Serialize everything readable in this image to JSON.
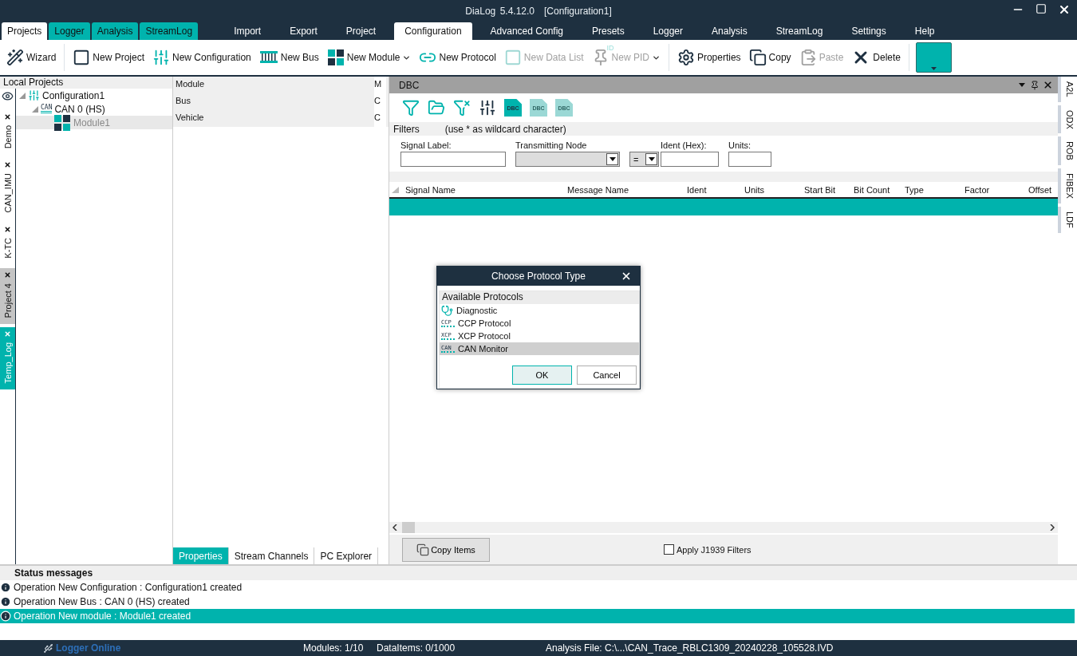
{
  "window": {
    "title": "DiaLog 5.4.12.0",
    "document": "[Configuration1]"
  },
  "side_tabs": [
    {
      "label": "Projects",
      "selected": true
    },
    {
      "label": "Logger",
      "selected": false
    },
    {
      "label": "Analysis",
      "selected": false
    },
    {
      "label": "StreamLog",
      "selected": false
    }
  ],
  "menu_tabs": [
    {
      "label": "Import",
      "selected": false
    },
    {
      "label": "Export",
      "selected": false
    },
    {
      "label": "Project",
      "selected": false
    },
    {
      "label": "Configuration",
      "selected": true
    },
    {
      "label": "Advanced Config",
      "selected": false
    },
    {
      "label": "Presets",
      "selected": false
    },
    {
      "label": "Logger",
      "selected": false
    },
    {
      "label": "Analysis",
      "selected": false
    },
    {
      "label": "StreamLog",
      "selected": false
    },
    {
      "label": "Settings",
      "selected": false
    },
    {
      "label": "Help",
      "selected": false
    }
  ],
  "toolbar": [
    {
      "kind": "button",
      "label": "Wizard",
      "disabled": false,
      "dropdown": false
    },
    {
      "kind": "separator"
    },
    {
      "kind": "button",
      "label": "New Project",
      "disabled": false,
      "dropdown": false
    },
    {
      "kind": "button",
      "label": "New Configuration",
      "disabled": false,
      "dropdown": false
    },
    {
      "kind": "button",
      "label": "New Bus",
      "disabled": false,
      "dropdown": false
    },
    {
      "kind": "button",
      "label": "New Module",
      "disabled": false,
      "dropdown": true
    },
    {
      "kind": "button",
      "label": "New Protocol",
      "disabled": false,
      "dropdown": false
    },
    {
      "kind": "button",
      "label": "New Data List",
      "disabled": true,
      "dropdown": false
    },
    {
      "kind": "button",
      "label": "New PID",
      "icon_text": "ID",
      "disabled": true,
      "dropdown": true
    },
    {
      "kind": "separator"
    },
    {
      "kind": "button",
      "label": "Properties",
      "disabled": false,
      "dropdown": false
    },
    {
      "kind": "button",
      "label": "Copy",
      "disabled": false,
      "dropdown": false
    },
    {
      "kind": "button",
      "label": "Paste",
      "disabled": true,
      "dropdown": false
    },
    {
      "kind": "button",
      "label": "Delete",
      "disabled": false,
      "dropdown": false
    },
    {
      "kind": "separator"
    },
    {
      "kind": "color_button"
    }
  ],
  "project_tabs": [
    {
      "label": "Demo",
      "selected": false,
      "hovered": false
    },
    {
      "label": "CAN_IMU",
      "selected": false,
      "hovered": false
    },
    {
      "label": "K-TC",
      "selected": false,
      "hovered": false
    },
    {
      "label": "Project 4",
      "selected": false,
      "hovered": true
    },
    {
      "label": "Temp_Log",
      "selected": true,
      "hovered": false
    }
  ],
  "tree": {
    "title": "Local Projects",
    "items": [
      {
        "label": "Configuration1",
        "expanded": true,
        "selected": false,
        "children": [
          {
            "label": "CAN 0 (HS)",
            "icon_text": "CAN",
            "expanded": true,
            "selected": false,
            "children": [
              {
                "label": "Module1",
                "selected": true
              }
            ]
          }
        ]
      }
    ]
  },
  "properties": {
    "rows": [
      {
        "name": "Module",
        "column_2": "M"
      },
      {
        "name": "Bus",
        "column_2": "C"
      },
      {
        "name": "Vehicle",
        "column_2": "C"
      }
    ],
    "tabs": [
      {
        "label": "Properties",
        "selected": true
      },
      {
        "label": "Stream Channels",
        "selected": false
      },
      {
        "label": "PC Explorer",
        "selected": false
      }
    ]
  },
  "dbc": {
    "title": "DBC",
    "tools": [
      {
        "disabled": false
      },
      {
        "disabled": false
      },
      {
        "disabled": false
      },
      {
        "disabled": false
      },
      {
        "icon_text": "DBC",
        "disabled": false
      },
      {
        "icon_text": "DBC",
        "disabled": true
      },
      {
        "icon_text": "DBC",
        "disabled": true
      }
    ],
    "filters_label": "Filters",
    "filters_hint": "(use * as wildcard character)",
    "fields": [
      {
        "kind": "text",
        "label": "Signal Label:"
      },
      {
        "kind": "select",
        "label": "Transmitting Node"
      },
      {
        "kind": "operator",
        "value": "="
      },
      {
        "kind": "text",
        "label": "Ident (Hex):"
      },
      {
        "kind": "text",
        "label": "Units:"
      }
    ],
    "columns": [
      "Signal Name",
      "Message Name",
      "Ident",
      "Units",
      "Start Bit",
      "Bit Count",
      "Type",
      "Factor",
      "Offset"
    ],
    "rows": [
      {
        "selected": true
      }
    ],
    "copy_button": "Copy Items",
    "j1939": {
      "label": "Apply J1939 Filters",
      "checked": false
    }
  },
  "dock_tabs": [
    "A2L",
    "ODX",
    "ROB",
    "FIBEX",
    "LDF"
  ],
  "dialog": {
    "title": "Choose Protocol Type",
    "header": "Available Protocols",
    "items": [
      {
        "label": "Diagnostic",
        "selected": false
      },
      {
        "label": "CCP Protocol",
        "icon_text": "CCP",
        "selected": false
      },
      {
        "label": "XCP Protocol",
        "icon_text": "XCP",
        "selected": false
      },
      {
        "label": "CAN Monitor",
        "icon_text": "CAN",
        "selected": true
      }
    ],
    "buttons": [
      {
        "label": "OK",
        "default": true
      },
      {
        "label": "Cancel",
        "default": false
      }
    ]
  },
  "status": {
    "title": "Status messages",
    "messages": [
      {
        "text": "Operation New Configuration : Configuration1 created",
        "selected": false
      },
      {
        "text": "Operation New Bus : CAN 0 (HS) created",
        "selected": false
      },
      {
        "text": "Operation New module : Module1 created",
        "selected": true
      }
    ]
  },
  "status_bar": {
    "connection": "Logger Online",
    "modules": "Modules: 1/10",
    "data_items": "DataItems: 0/1000",
    "analysis_file": "Analysis File: C:\\...\\CAN_Trace_RBLC1309_20240228_105528.IVD"
  }
}
